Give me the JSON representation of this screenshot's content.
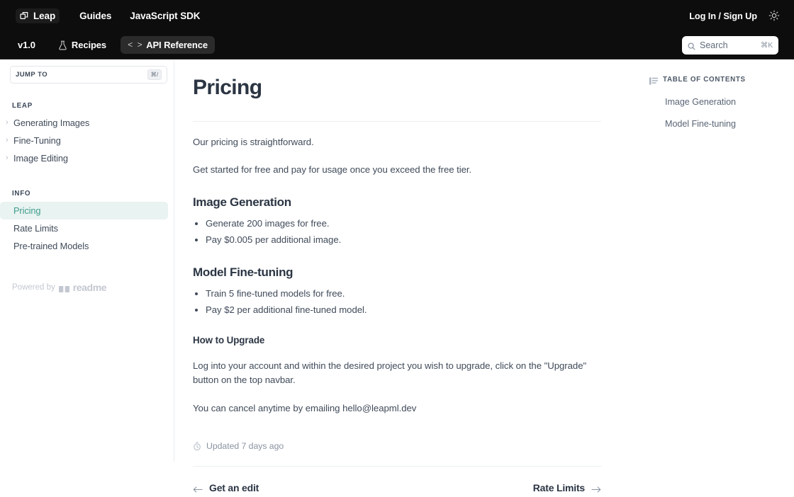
{
  "topnav": {
    "logo_text": "Leap",
    "logo_icon": "leap-cube-icon",
    "links": [
      {
        "label": "Guides"
      },
      {
        "label": "JavaScript SDK"
      }
    ],
    "login_label": "Log In / Sign Up",
    "theme_toggle_icon": "sun-icon"
  },
  "subnav": {
    "version": "v1.0",
    "tabs": [
      {
        "label": "Recipes",
        "icon": "flask-icon",
        "active": false
      },
      {
        "label": "API Reference",
        "icon": "code-brackets-icon",
        "active": true
      }
    ],
    "search": {
      "placeholder": "Search",
      "icon": "search-icon",
      "shortcut": "⌘K",
      "value": ""
    }
  },
  "sidebar": {
    "jump_to": {
      "label": "JUMP TO",
      "shortcut": "⌘/"
    },
    "sections": [
      {
        "title": "LEAP",
        "items": [
          {
            "label": "Generating Images",
            "expandable": true,
            "active": false
          },
          {
            "label": "Fine-Tuning",
            "expandable": true,
            "active": false
          },
          {
            "label": "Image Editing",
            "expandable": true,
            "active": false
          }
        ]
      },
      {
        "title": "INFO",
        "items": [
          {
            "label": "Pricing",
            "expandable": false,
            "active": true
          },
          {
            "label": "Rate Limits",
            "expandable": false,
            "active": false
          },
          {
            "label": "Pre-trained Models",
            "expandable": false,
            "active": false
          }
        ]
      }
    ],
    "footer": {
      "powered_by": "Powered by",
      "brand": "readme",
      "brand_icon": "readme-book-icon"
    }
  },
  "main": {
    "title": "Pricing",
    "intro_1": "Our pricing is straightforward.",
    "intro_2": "Get started for free and pay for usage once you exceed the free tier.",
    "section_image_generation": {
      "heading": "Image Generation",
      "bullets": [
        "Generate 200 images for free.",
        "Pay $0.005 per additional image."
      ]
    },
    "section_model_finetuning": {
      "heading": "Model Fine-tuning",
      "bullets": [
        "Train 5 fine-tuned models for free.",
        "Pay $2 per additional fine-tuned model."
      ]
    },
    "section_upgrade": {
      "heading": "How to Upgrade",
      "paragraph_1": "Log into your account and within the desired project you wish to upgrade, click on the \"Upgrade\" button on the top navbar.",
      "paragraph_2": "You can cancel anytime by emailing hello@leapml.dev"
    },
    "updated": {
      "icon": "clock-icon",
      "text": "Updated 7 days ago"
    },
    "pagenav": {
      "prev_label": "Get an edit",
      "prev_icon": "arrow-left-icon",
      "next_label": "Rate Limits",
      "next_icon": "arrow-right-icon"
    }
  },
  "toc": {
    "icon": "list-lines-icon",
    "title": "TABLE OF CONTENTS",
    "links": [
      {
        "label": "Image Generation"
      },
      {
        "label": "Model Fine-tuning"
      }
    ]
  },
  "colors": {
    "nav_background": "#0d0d0d",
    "accent_active": "#3e9c8c",
    "accent_active_bg": "#e9f3f1",
    "text_primary": "#2b3543",
    "text_body": "#404b5a",
    "text_muted": "#8a94a2",
    "border": "#eceef1",
    "readme_grey": "#c3c8d1"
  }
}
